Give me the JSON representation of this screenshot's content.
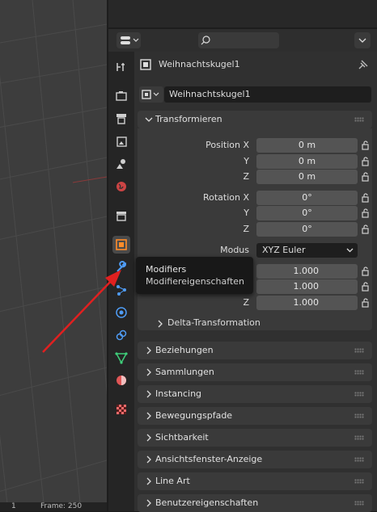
{
  "viewport": {
    "footer_left": "1",
    "footer_right": "Frame: 250"
  },
  "header": {
    "editor_icon": "properties-editor-icon",
    "search_icon": "search-icon"
  },
  "object": {
    "name": "Weihnachtskugel1",
    "datablock_name": "Weihnachtskugel1"
  },
  "transform": {
    "title": "Transformieren",
    "location_label_x": "Position X",
    "location_label_y": "Y",
    "location_label_z": "Z",
    "location_x": "0 m",
    "location_y": "0 m",
    "location_z": "0 m",
    "rotation_label_x": "Rotation X",
    "rotation_label_y": "Y",
    "rotation_label_z": "Z",
    "rotation_x": "0°",
    "rotation_y": "0°",
    "rotation_z": "0°",
    "mode_label": "Modus",
    "mode_value": "XYZ Euler",
    "scale_label_z": "Z",
    "scale_x": "1.000",
    "scale_y": "1.000",
    "scale_z": "1.000",
    "delta_title": "Delta-Transformation"
  },
  "panels": [
    "Beziehungen",
    "Sammlungen",
    "Instancing",
    "Bewegungspfade",
    "Sichtbarkeit",
    "Ansichtsfenster-Anzeige",
    "Line Art",
    "Benutzereigenschaften"
  ],
  "tooltip": {
    "title": "Modifiers",
    "subtitle": "Modifiereigenschaften"
  },
  "colors": {
    "object_accent": "#ff8c2a",
    "modifier_accent": "#4f9cf5",
    "annotation_arrow": "#e02020"
  }
}
